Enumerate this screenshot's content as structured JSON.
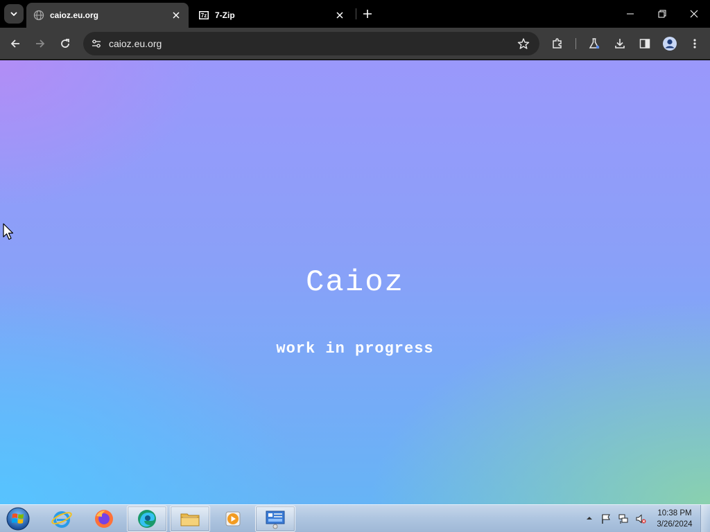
{
  "browser": {
    "tabs": [
      {
        "label": "caioz.eu.org",
        "active": true
      },
      {
        "label": "7-Zip",
        "active": false
      }
    ],
    "url": "caioz.eu.org"
  },
  "page": {
    "title": "Caioz",
    "subtitle": "work in progress"
  },
  "taskbar": {
    "apps": [
      "Internet Explorer",
      "Firefox",
      "Edge",
      "File Explorer",
      "Media Player",
      "Control Panel"
    ],
    "clock": {
      "time": "10:38 PM",
      "date": "3/26/2024"
    }
  },
  "colors": {
    "tab_bar": "#000000",
    "toolbar": "#3c3c3c",
    "omnibox": "#282828",
    "page_top": "#9a98fb",
    "page_bottom_left": "#56c4ff",
    "page_bottom_right": "#8cd2aa"
  }
}
